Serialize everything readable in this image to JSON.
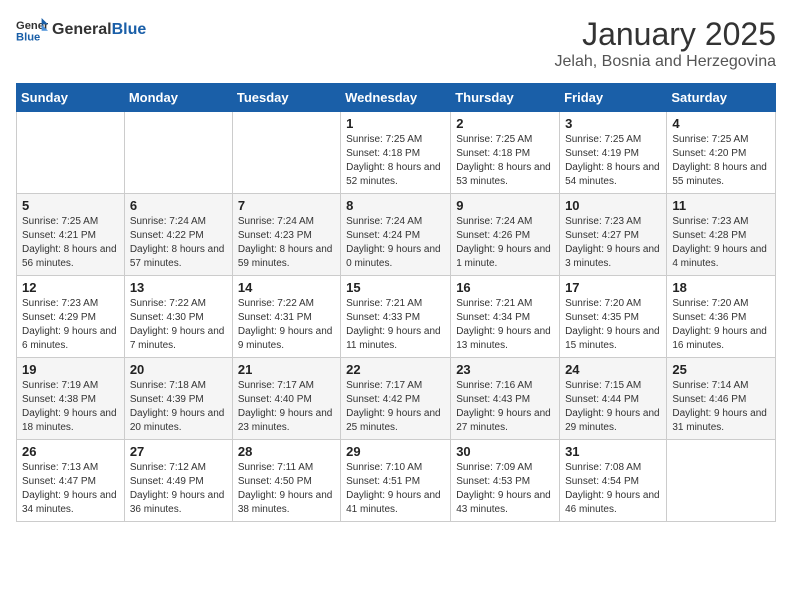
{
  "header": {
    "logo_general": "General",
    "logo_blue": "Blue",
    "month": "January 2025",
    "location": "Jelah, Bosnia and Herzegovina"
  },
  "weekdays": [
    "Sunday",
    "Monday",
    "Tuesday",
    "Wednesday",
    "Thursday",
    "Friday",
    "Saturday"
  ],
  "weeks": [
    [
      {
        "day": "",
        "info": ""
      },
      {
        "day": "",
        "info": ""
      },
      {
        "day": "",
        "info": ""
      },
      {
        "day": "1",
        "info": "Sunrise: 7:25 AM\nSunset: 4:18 PM\nDaylight: 8 hours and 52 minutes."
      },
      {
        "day": "2",
        "info": "Sunrise: 7:25 AM\nSunset: 4:18 PM\nDaylight: 8 hours and 53 minutes."
      },
      {
        "day": "3",
        "info": "Sunrise: 7:25 AM\nSunset: 4:19 PM\nDaylight: 8 hours and 54 minutes."
      },
      {
        "day": "4",
        "info": "Sunrise: 7:25 AM\nSunset: 4:20 PM\nDaylight: 8 hours and 55 minutes."
      }
    ],
    [
      {
        "day": "5",
        "info": "Sunrise: 7:25 AM\nSunset: 4:21 PM\nDaylight: 8 hours and 56 minutes."
      },
      {
        "day": "6",
        "info": "Sunrise: 7:24 AM\nSunset: 4:22 PM\nDaylight: 8 hours and 57 minutes."
      },
      {
        "day": "7",
        "info": "Sunrise: 7:24 AM\nSunset: 4:23 PM\nDaylight: 8 hours and 59 minutes."
      },
      {
        "day": "8",
        "info": "Sunrise: 7:24 AM\nSunset: 4:24 PM\nDaylight: 9 hours and 0 minutes."
      },
      {
        "day": "9",
        "info": "Sunrise: 7:24 AM\nSunset: 4:26 PM\nDaylight: 9 hours and 1 minute."
      },
      {
        "day": "10",
        "info": "Sunrise: 7:23 AM\nSunset: 4:27 PM\nDaylight: 9 hours and 3 minutes."
      },
      {
        "day": "11",
        "info": "Sunrise: 7:23 AM\nSunset: 4:28 PM\nDaylight: 9 hours and 4 minutes."
      }
    ],
    [
      {
        "day": "12",
        "info": "Sunrise: 7:23 AM\nSunset: 4:29 PM\nDaylight: 9 hours and 6 minutes."
      },
      {
        "day": "13",
        "info": "Sunrise: 7:22 AM\nSunset: 4:30 PM\nDaylight: 9 hours and 7 minutes."
      },
      {
        "day": "14",
        "info": "Sunrise: 7:22 AM\nSunset: 4:31 PM\nDaylight: 9 hours and 9 minutes."
      },
      {
        "day": "15",
        "info": "Sunrise: 7:21 AM\nSunset: 4:33 PM\nDaylight: 9 hours and 11 minutes."
      },
      {
        "day": "16",
        "info": "Sunrise: 7:21 AM\nSunset: 4:34 PM\nDaylight: 9 hours and 13 minutes."
      },
      {
        "day": "17",
        "info": "Sunrise: 7:20 AM\nSunset: 4:35 PM\nDaylight: 9 hours and 15 minutes."
      },
      {
        "day": "18",
        "info": "Sunrise: 7:20 AM\nSunset: 4:36 PM\nDaylight: 9 hours and 16 minutes."
      }
    ],
    [
      {
        "day": "19",
        "info": "Sunrise: 7:19 AM\nSunset: 4:38 PM\nDaylight: 9 hours and 18 minutes."
      },
      {
        "day": "20",
        "info": "Sunrise: 7:18 AM\nSunset: 4:39 PM\nDaylight: 9 hours and 20 minutes."
      },
      {
        "day": "21",
        "info": "Sunrise: 7:17 AM\nSunset: 4:40 PM\nDaylight: 9 hours and 23 minutes."
      },
      {
        "day": "22",
        "info": "Sunrise: 7:17 AM\nSunset: 4:42 PM\nDaylight: 9 hours and 25 minutes."
      },
      {
        "day": "23",
        "info": "Sunrise: 7:16 AM\nSunset: 4:43 PM\nDaylight: 9 hours and 27 minutes."
      },
      {
        "day": "24",
        "info": "Sunrise: 7:15 AM\nSunset: 4:44 PM\nDaylight: 9 hours and 29 minutes."
      },
      {
        "day": "25",
        "info": "Sunrise: 7:14 AM\nSunset: 4:46 PM\nDaylight: 9 hours and 31 minutes."
      }
    ],
    [
      {
        "day": "26",
        "info": "Sunrise: 7:13 AM\nSunset: 4:47 PM\nDaylight: 9 hours and 34 minutes."
      },
      {
        "day": "27",
        "info": "Sunrise: 7:12 AM\nSunset: 4:49 PM\nDaylight: 9 hours and 36 minutes."
      },
      {
        "day": "28",
        "info": "Sunrise: 7:11 AM\nSunset: 4:50 PM\nDaylight: 9 hours and 38 minutes."
      },
      {
        "day": "29",
        "info": "Sunrise: 7:10 AM\nSunset: 4:51 PM\nDaylight: 9 hours and 41 minutes."
      },
      {
        "day": "30",
        "info": "Sunrise: 7:09 AM\nSunset: 4:53 PM\nDaylight: 9 hours and 43 minutes."
      },
      {
        "day": "31",
        "info": "Sunrise: 7:08 AM\nSunset: 4:54 PM\nDaylight: 9 hours and 46 minutes."
      },
      {
        "day": "",
        "info": ""
      }
    ]
  ]
}
